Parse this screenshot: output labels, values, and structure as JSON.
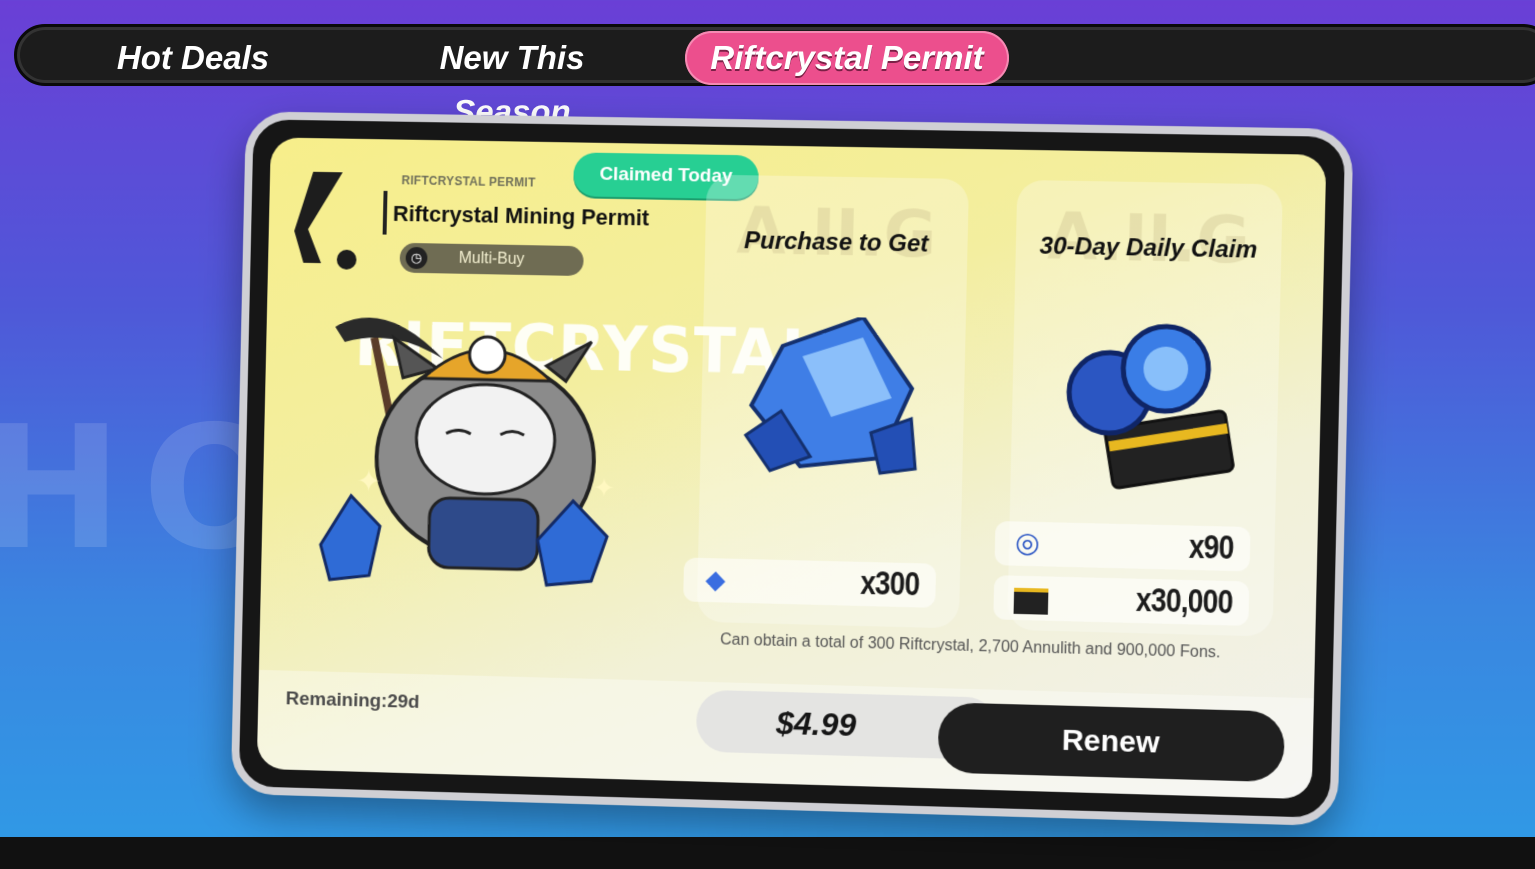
{
  "tabs": [
    {
      "label": "Hot Deals",
      "active": false
    },
    {
      "label": "New This Season",
      "active": false
    },
    {
      "label": "Riftcrystal Permit",
      "active": true
    }
  ],
  "background_watermark": "HOT DEAL",
  "permit": {
    "pre_title": "RIFTCRYSTAL PERMIT",
    "title": "Riftcrystal Mining Permit",
    "tag": "Multi-Buy",
    "status_badge": "Claimed Today",
    "art_text": "RIFTCRYSTAL"
  },
  "cards": {
    "purchase": {
      "title": "Purchase to Get",
      "watermark": "A.II.G",
      "rewards": [
        {
          "icon": "riftcrystal-icon",
          "qty": "x300"
        }
      ]
    },
    "daily": {
      "title": "30-Day Daily Claim",
      "watermark": "A.II.G",
      "rewards": [
        {
          "icon": "annulith-icon",
          "qty": "x90"
        },
        {
          "icon": "fons-ticket-icon",
          "qty": "x30,000"
        }
      ]
    }
  },
  "description": "Can obtain a total of 300 Riftcrystal, 2,700 Annulith and 900,000 Fons.",
  "remaining": "Remaining:29d",
  "price": "$4.99",
  "renew_label": "Renew",
  "colors": {
    "active_tab": "#ec4f8d",
    "badge_green": "#27cf93",
    "renew_dark": "#1f1f1f"
  }
}
